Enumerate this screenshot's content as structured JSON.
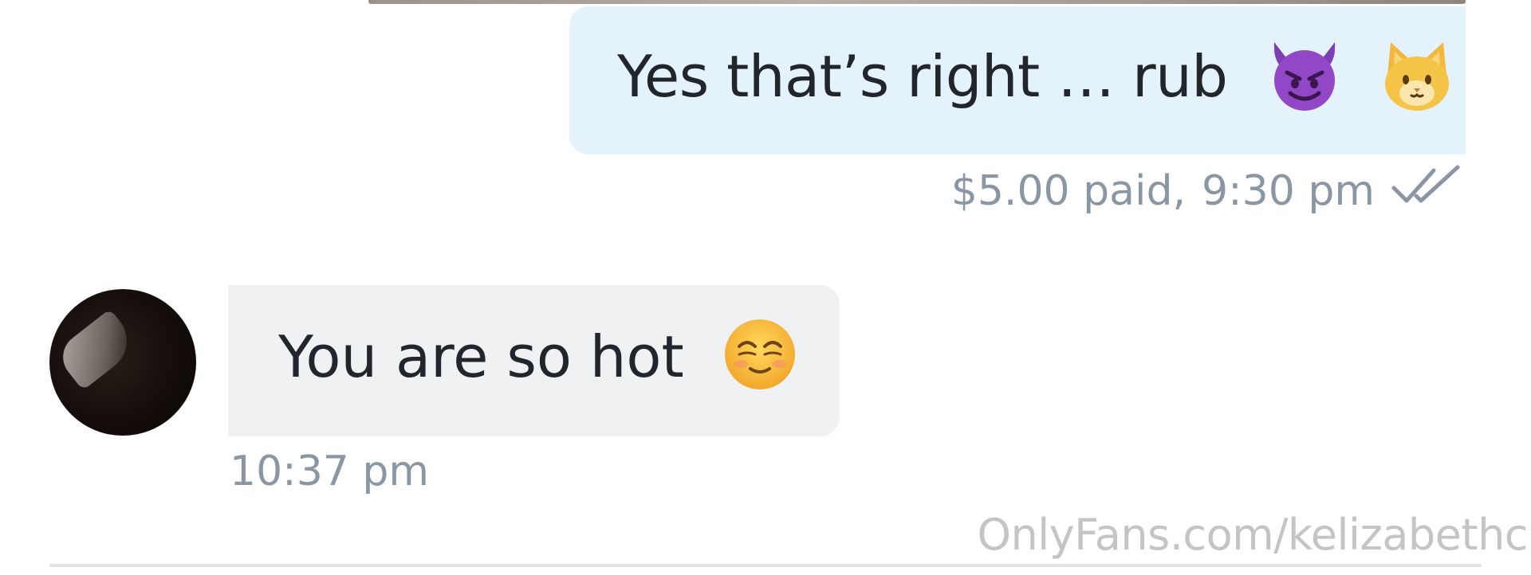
{
  "outgoing_message": {
    "text": "Yes that’s right … rub",
    "emojis": [
      "smiling-devil-emoji",
      "cat-face-emoji"
    ],
    "price_paid": "$5.00 paid,",
    "time": "9:30 pm",
    "status_icon": "double-check-icon"
  },
  "incoming_message": {
    "text": "You are so hot",
    "emoji": "smiling-face-emoji",
    "time": "10:37 pm",
    "avatar": "profile-avatar"
  },
  "watermark": "OnlyFans.com/kelizabethc",
  "colors": {
    "outgoing_bubble": "#e4f2fb",
    "incoming_bubble": "#f0f1f3",
    "meta_text": "#8a96a3",
    "message_text": "#20262b"
  }
}
